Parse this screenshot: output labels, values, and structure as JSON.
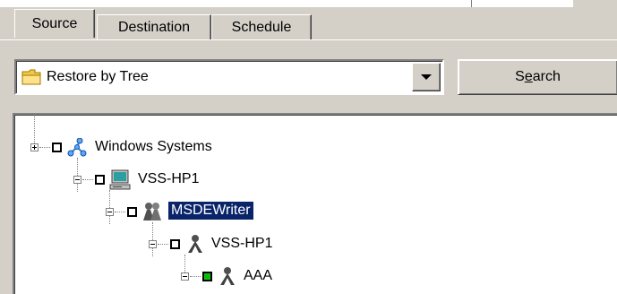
{
  "tabs": [
    {
      "label": "Source",
      "active": true
    },
    {
      "label": "Destination",
      "active": false
    },
    {
      "label": "Schedule",
      "active": false
    }
  ],
  "restore_combo": {
    "value": "Restore by Tree",
    "icon": "folder-icon"
  },
  "search_button": {
    "label_pre": "S",
    "label_underlined": "e",
    "label_post": "arch"
  },
  "tree": {
    "nodes": [
      {
        "label": "Windows Systems",
        "expander": "plus",
        "icon": "network-icon",
        "checkbox": "empty",
        "selected": false
      },
      {
        "label": "VSS-HP1",
        "expander": "minus",
        "icon": "computer-icon",
        "checkbox": "empty",
        "selected": false
      },
      {
        "label": "MSDEWriter",
        "expander": "minus",
        "icon": "writer-group-icon",
        "checkbox": "empty",
        "selected": true
      },
      {
        "label": "VSS-HP1",
        "expander": "minus",
        "icon": "component-icon",
        "checkbox": "empty",
        "selected": false
      },
      {
        "label": "AAA",
        "expander": "minus",
        "icon": "component-icon",
        "checkbox": "green",
        "selected": false
      }
    ]
  },
  "colors": {
    "window_bg": "#d4d0c8",
    "selection": "#0a246a",
    "checked": "#1fbf1f"
  }
}
